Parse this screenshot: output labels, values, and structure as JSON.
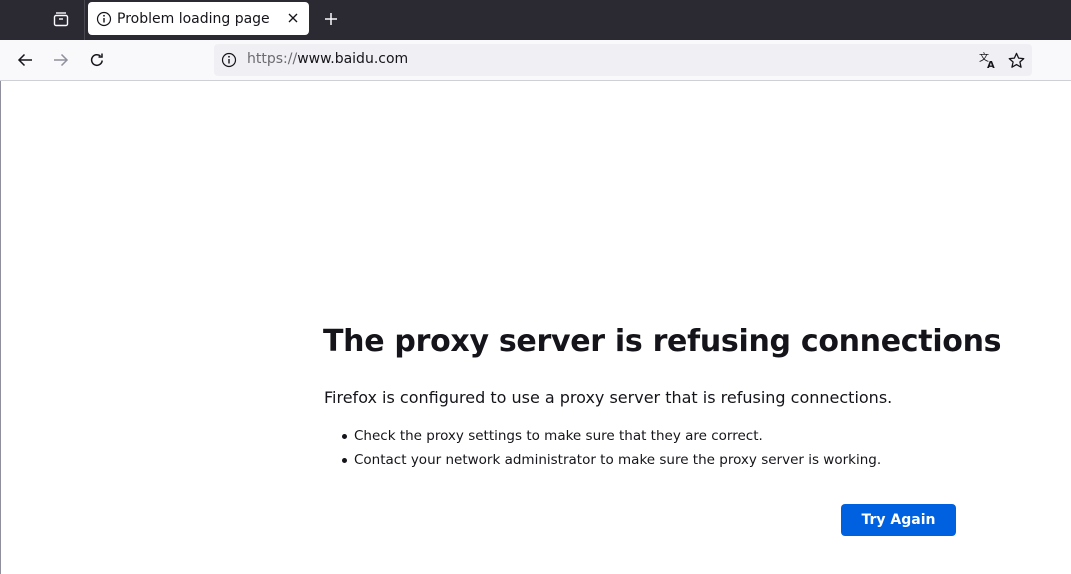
{
  "tabs": [
    {
      "title": "Problem loading page",
      "active": true
    }
  ],
  "urlbar": {
    "protocol": "https://",
    "host": "www.baidu.com"
  },
  "error": {
    "title": "The proxy server is refusing connections",
    "description": "Firefox is configured to use a proxy server that is refusing connections.",
    "suggestions": [
      "Check the proxy settings to make sure that they are correct.",
      "Contact your network administrator to make sure the proxy server is working."
    ],
    "try_again_label": "Try Again"
  },
  "icons": {
    "tab_list": "tab-list-icon",
    "tab_info": "info-icon",
    "tab_close": "close-icon",
    "new_tab": "plus-icon",
    "back": "back-arrow-icon",
    "forward": "forward-arrow-icon",
    "reload": "reload-icon",
    "site_info": "info-icon",
    "translate": "translate-icon",
    "bookmark": "star-icon"
  },
  "colors": {
    "tabstrip": "#2b2a33",
    "accent_button": "#0061e0",
    "text": "#15141a"
  }
}
